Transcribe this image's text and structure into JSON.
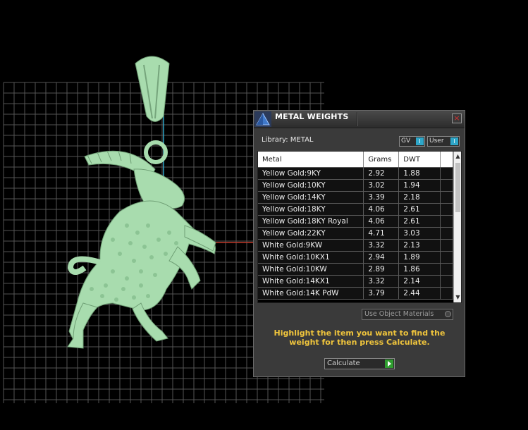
{
  "dialog": {
    "title": "METAL WEIGHTS",
    "close_symbol": "×",
    "library_label": "Library: METAL",
    "toggles": [
      {
        "label": "GV",
        "indicator": "I"
      },
      {
        "label": "User",
        "indicator": "I"
      }
    ],
    "table": {
      "headers": [
        "Metal",
        "Grams",
        "DWT"
      ],
      "rows": [
        {
          "metal": "Yellow Gold:9KY",
          "grams": "2.92",
          "dwt": "1.88"
        },
        {
          "metal": "Yellow Gold:10KY",
          "grams": "3.02",
          "dwt": "1.94"
        },
        {
          "metal": "Yellow Gold:14KY",
          "grams": "3.39",
          "dwt": "2.18"
        },
        {
          "metal": "Yellow Gold:18KY",
          "grams": "4.06",
          "dwt": "2.61"
        },
        {
          "metal": "Yellow Gold:18KY Royal",
          "grams": "4.06",
          "dwt": "2.61"
        },
        {
          "metal": "Yellow Gold:22KY",
          "grams": "4.71",
          "dwt": "3.03"
        },
        {
          "metal": "White Gold:9KW",
          "grams": "3.32",
          "dwt": "2.13"
        },
        {
          "metal": "White Gold:10KX1",
          "grams": "2.94",
          "dwt": "1.89"
        },
        {
          "metal": "White Gold:10KW",
          "grams": "2.89",
          "dwt": "1.86"
        },
        {
          "metal": "White Gold:14KX1",
          "grams": "3.32",
          "dwt": "2.14"
        },
        {
          "metal": "White Gold:14K PdW",
          "grams": "3.79",
          "dwt": "2.44"
        }
      ]
    },
    "use_object_materials_label": "Use Object Materials",
    "instructions": "Highlight the item you want to find the weight for then press Calculate.",
    "calculate_label": "Calculate"
  },
  "colors": {
    "background": "#000000",
    "grid": "#5a5a5a",
    "model": "#a8dcae",
    "accent_cyan": "#2ea6c8",
    "axis_red": "#c23a2a",
    "instruction_text": "#f0c53c",
    "calc_arrow": "#2f9d2f"
  },
  "icons": {
    "app": "pyramid-logo-icon",
    "close": "close-icon",
    "calculate": "play-arrow-icon"
  }
}
